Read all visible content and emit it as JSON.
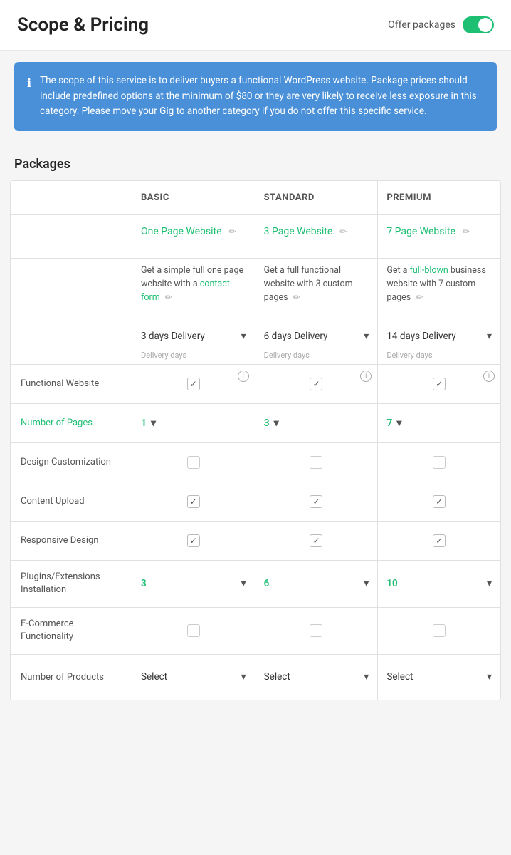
{
  "header": {
    "title": "Scope & Pricing",
    "offer_packages_label": "Offer packages"
  },
  "info_box": {
    "text": "The scope of this service is to deliver buyers a functional WordPress website. Package prices should include predefined options at the minimum of $80 or they are very likely to receive less exposure in this category. Please move your Gig to another category if you do not offer this specific service."
  },
  "packages_section": {
    "title": "Packages"
  },
  "columns": {
    "basic": "BASIC",
    "standard": "STANDARD",
    "premium": "PREMIUM"
  },
  "package_names": {
    "basic": "One Page Website",
    "standard": "3 Page Website",
    "premium": "7 Page Website"
  },
  "package_descriptions": {
    "basic": "Get a simple full one page website with a contact form",
    "standard": "Get a full functional website with 3 custom pages",
    "premium": "Get a full-blown business website with 7 custom pages"
  },
  "delivery": {
    "basic": "3 days Delivery",
    "standard": "6 days Delivery",
    "premium": "14 days Delivery",
    "days_label": "Delivery days"
  },
  "rows": {
    "functional_website": "Functional Website",
    "number_of_pages": "Number of Pages",
    "design_customization": "Design Customization",
    "content_upload": "Content Upload",
    "responsive_design": "Responsive Design",
    "plugins_installation": "Plugins/Extensions Installation",
    "ecommerce": "E-Commerce Functionality",
    "number_of_products": "Number of Products"
  },
  "number_of_pages": {
    "basic": "1",
    "standard": "3",
    "premium": "7"
  },
  "plugins": {
    "basic": "3",
    "standard": "6",
    "premium": "10"
  },
  "select_label": "Select"
}
